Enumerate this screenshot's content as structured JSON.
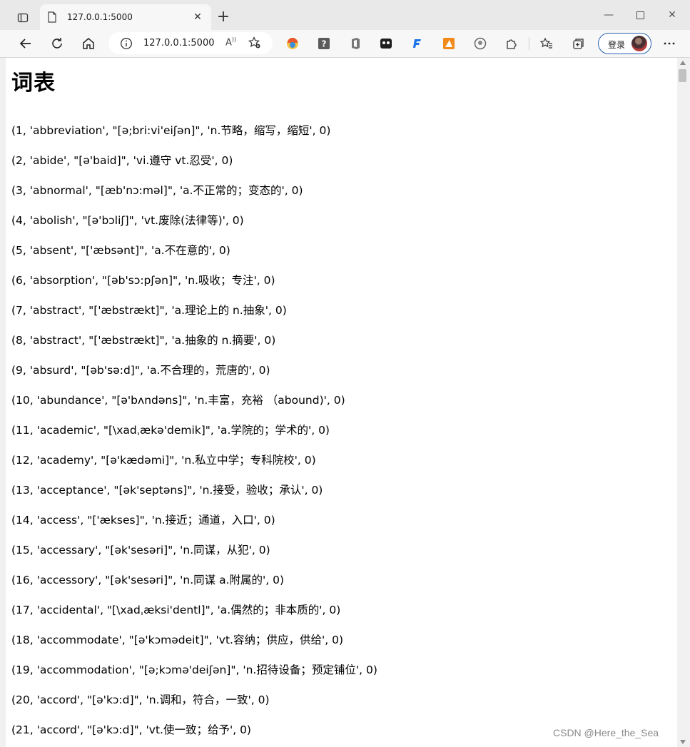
{
  "browser": {
    "tab_title": "127.0.0.1:5000",
    "address_url": "127.0.0.1:5000",
    "login_label": "登录",
    "extensions": [
      "colorful-bird-icon",
      "help-icon",
      "office-icon",
      "tiles-icon",
      "f-icon",
      "orange-app-icon",
      "github-icon",
      "puzzle-icon"
    ]
  },
  "page": {
    "title": "词表",
    "rows": [
      "(1, 'abbreviation', \"[ə;bri:vi'eiʃən]\", 'n.节略，缩写，缩短', 0)",
      "(2, 'abide', \"[ə'baid]\", 'vi.遵守 vt.忍受', 0)",
      "(3, 'abnormal', \"[æb'nɔ:məl]\", 'a.不正常的；变态的', 0)",
      "(4, 'abolish', \"[ə'bɔliʃ]\", 'vt.废除(法律等)', 0)",
      "(5, 'absent', \"['æbsənt]\", 'a.不在意的', 0)",
      "(6, 'absorption', \"[əb'sɔ:pʃən]\", 'n.吸收；专注', 0)",
      "(7, 'abstract', \"['æbstrækt]\", 'a.理论上的 n.抽象', 0)",
      "(8, 'abstract', \"['æbstrækt]\", 'a.抽象的 n.摘要', 0)",
      "(9, 'absurd', \"[əb'sə:d]\", 'a.不合理的，荒唐的', 0)",
      "(10, 'abundance', \"[ə'bʌndəns]\", 'n.丰富，充裕 （abound)', 0)",
      "(11, 'academic', \"[\\xadˌækə'demik]\", 'a.学院的；学术的', 0)",
      "(12, 'academy', \"[ə'kædəmi]\", 'n.私立中学；专科院校', 0)",
      "(13, 'acceptance', \"[ək'septəns]\", 'n.接受，验收；承认', 0)",
      "(14, 'access', \"['ækses]\", 'n.接近；通道，入口', 0)",
      "(15, 'accessary', \"[ək'sesəri]\", 'n.同谋，从犯', 0)",
      "(16, 'accessory', \"[ək'sesəri]\", 'n.同谋 a.附属的', 0)",
      "(17, 'accidental', \"[\\xadˌæksi'dentl]\", 'a.偶然的；非本质的', 0)",
      "(18, 'accommodate', \"[ə'kɔmədeit]\", 'vt.容纳；供应，供给', 0)",
      "(19, 'accommodation', \"[ə;kɔmə'deiʃən]\", 'n.招待设备；预定铺位', 0)",
      "(20, 'accord', \"[ə'kɔ:d]\", 'n.调和，符合，一致', 0)",
      "(21, 'accord', \"[ə'kɔ:d]\", 'vt.使一致；给予', 0)"
    ]
  },
  "watermark": "CSDN @Here_the_Sea"
}
